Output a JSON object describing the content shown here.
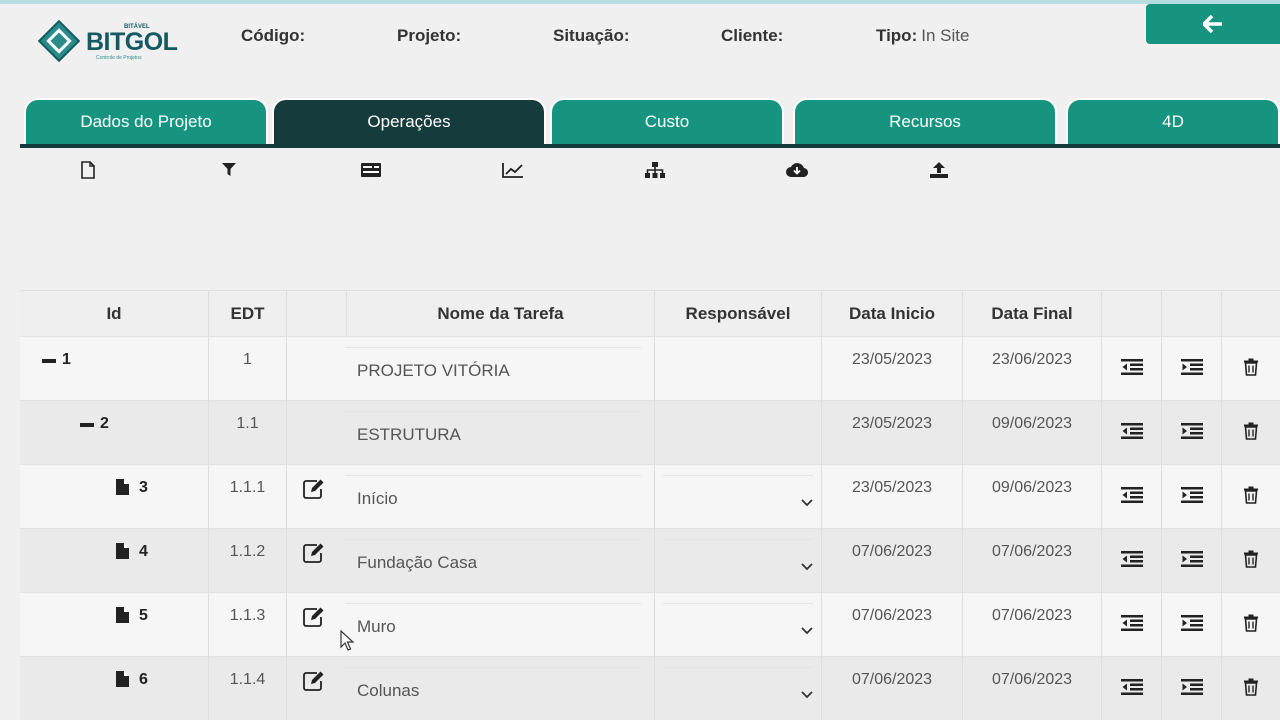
{
  "header": {
    "brand": "BITGOL",
    "brand_top": "BITÁVEL",
    "tagline": "Controle de Projetos",
    "fields": [
      {
        "label": "Código:",
        "value": ""
      },
      {
        "label": "Projeto:",
        "value": ""
      },
      {
        "label": "Situação:",
        "value": ""
      },
      {
        "label": "Cliente:",
        "value": ""
      },
      {
        "label": "Tipo:",
        "value": "In Site"
      }
    ],
    "back_icon": "arrow-left-icon"
  },
  "tabs": [
    {
      "label": "Dados do Projeto",
      "active": false
    },
    {
      "label": "Operações",
      "active": true
    },
    {
      "label": "Custo",
      "active": false
    },
    {
      "label": "Recursos",
      "active": false
    },
    {
      "label": "4D",
      "active": false
    }
  ],
  "toolbar": [
    "new-file-icon",
    "filter-icon",
    "list-card-icon",
    "line-chart-icon",
    "hierarchy-icon",
    "cloud-download-icon",
    "upload-icon"
  ],
  "table": {
    "columns": [
      "Id",
      "EDT",
      "",
      "Nome da Tarefa",
      "Responsável",
      "Data Inicio",
      "Data Final"
    ],
    "rows": [
      {
        "id": "1",
        "edt": "1",
        "name": "PROJETO VITÓRIA",
        "start": "23/05/2023",
        "end": "23/06/2023"
      },
      {
        "id": "2",
        "edt": "1.1",
        "name": "ESTRUTURA",
        "start": "23/05/2023",
        "end": "09/06/2023"
      },
      {
        "id": "3",
        "edt": "1.1.1",
        "name": "Início",
        "start": "23/05/2023",
        "end": "09/06/2023"
      },
      {
        "id": "4",
        "edt": "1.1.2",
        "name": "Fundação Casa",
        "start": "07/06/2023",
        "end": "07/06/2023"
      },
      {
        "id": "5",
        "edt": "1.1.3",
        "name": "Muro",
        "start": "07/06/2023",
        "end": "07/06/2023"
      },
      {
        "id": "6",
        "edt": "1.1.4",
        "name": "Colunas",
        "start": "07/06/2023",
        "end": "07/06/2023"
      }
    ]
  },
  "colors": {
    "accent": "#16947f",
    "dark": "#163b3c"
  }
}
